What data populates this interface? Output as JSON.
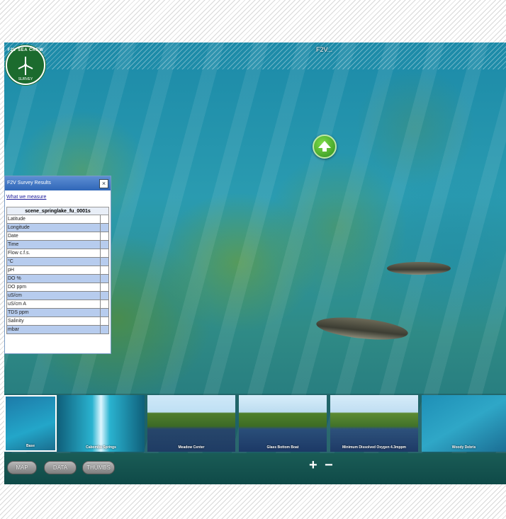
{
  "viewer": {
    "title": "F2V..."
  },
  "logo": {
    "text_top": "F2V SEA CREW",
    "text_bottom": "SURVEY"
  },
  "panel": {
    "title": "F2V Survey Results",
    "close_label": "×",
    "link": "What we measure",
    "scene": "scene_springlake_fu_0001s",
    "rows": [
      "Latitude",
      "Longitude",
      "Date",
      "Time",
      "Flow c.f.s.",
      "°C",
      "pH",
      "DO %",
      "DO ppm",
      "uS/cm",
      "uS/cm A",
      "TDS ppm",
      "Salinity",
      "mbar"
    ]
  },
  "thumbnails": [
    {
      "label": "Base"
    },
    {
      "label": "Cabomba Springs"
    },
    {
      "label": "Meadow Center"
    },
    {
      "label": "Glass Bottom Boat"
    },
    {
      "label": "Minimum Dissolved Oxygen 4.3mppm"
    },
    {
      "label": "Woody Debris"
    }
  ],
  "toolbar": {
    "map": "MAP",
    "data": "DATA",
    "thumbs": "THUMBS",
    "zoom_in": "+",
    "zoom_out": "−"
  },
  "colors": {
    "panel_header": "#3a72c4",
    "row_alt": "#b7ccee",
    "nav_arrow": "#3fa52a",
    "toolbar": "#145652"
  }
}
